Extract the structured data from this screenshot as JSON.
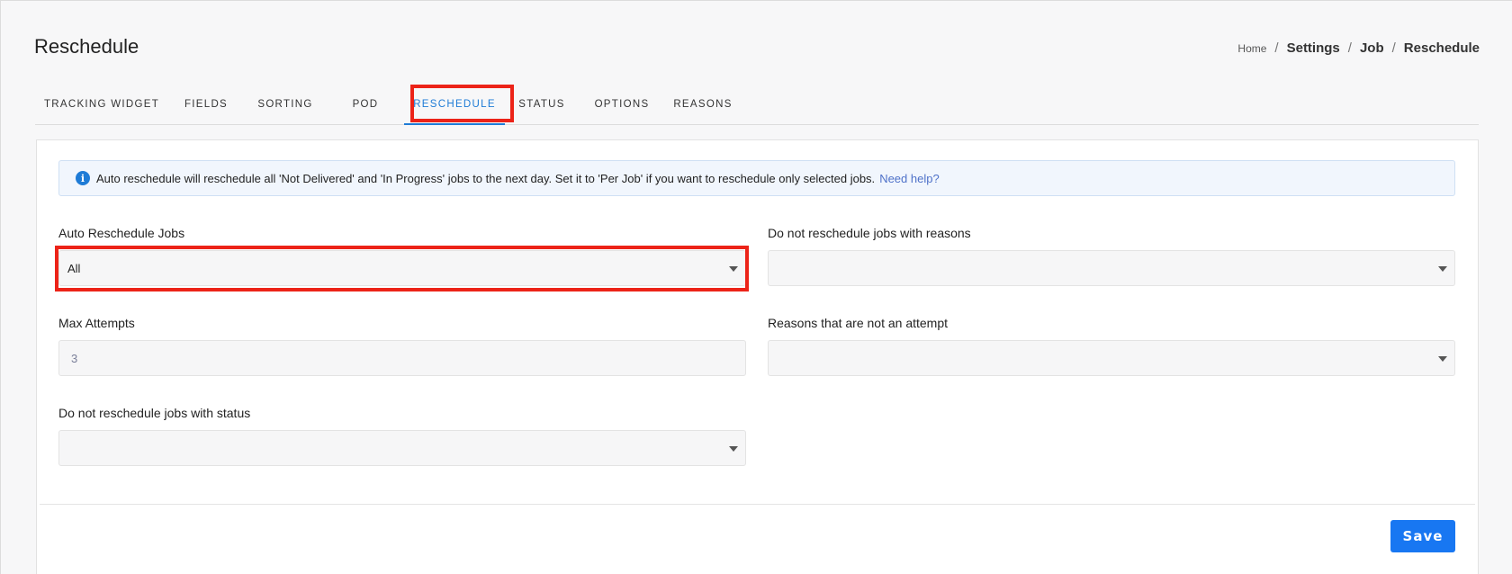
{
  "header": {
    "title": "Reschedule",
    "breadcrumb": [
      "Home",
      "Settings",
      "Job",
      "Reschedule"
    ],
    "separator": "/"
  },
  "tabs": [
    {
      "label": "TRACKING WIDGET"
    },
    {
      "label": "FIELDS"
    },
    {
      "label": "SORTING"
    },
    {
      "label": "POD"
    },
    {
      "label": "RESCHEDULE",
      "active": true
    },
    {
      "label": "STATUS"
    },
    {
      "label": "OPTIONS"
    },
    {
      "label": "REASONS"
    }
  ],
  "info": {
    "icon": "info-icon",
    "text": "Auto reschedule will reschedule all 'Not Delivered' and 'In Progress' jobs to the next day. Set it to 'Per Job' if you want to reschedule only selected jobs.",
    "link": "Need help?"
  },
  "form": {
    "auto_reschedule": {
      "label": "Auto Reschedule Jobs",
      "value": "All"
    },
    "no_reschedule_reasons": {
      "label": "Do not reschedule jobs with reasons",
      "value": ""
    },
    "max_attempts": {
      "label": "Max Attempts",
      "value": "3"
    },
    "not_attempt_reasons": {
      "label": "Reasons that are not an attempt",
      "value": ""
    },
    "no_reschedule_status": {
      "label": "Do not reschedule jobs with status",
      "value": ""
    }
  },
  "actions": {
    "save_label": "Save"
  },
  "colors": {
    "accent": "#1e7bd6",
    "save_button": "#1877f2",
    "highlight": "#ec2318"
  }
}
